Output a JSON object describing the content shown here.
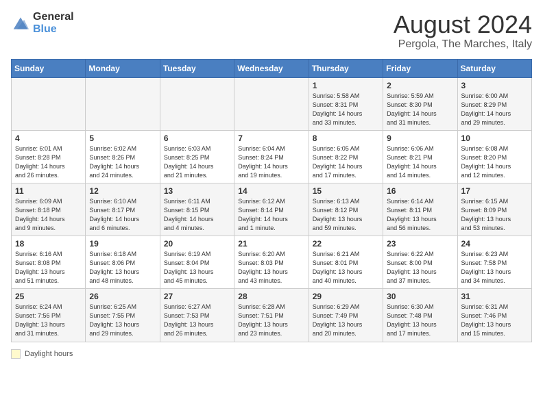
{
  "header": {
    "logo_general": "General",
    "logo_blue": "Blue",
    "month_title": "August 2024",
    "location": "Pergola, The Marches, Italy"
  },
  "days_of_week": [
    "Sunday",
    "Monday",
    "Tuesday",
    "Wednesday",
    "Thursday",
    "Friday",
    "Saturday"
  ],
  "footer": {
    "legend_label": "Daylight hours"
  },
  "weeks": [
    [
      {
        "day": "",
        "info": ""
      },
      {
        "day": "",
        "info": ""
      },
      {
        "day": "",
        "info": ""
      },
      {
        "day": "",
        "info": ""
      },
      {
        "day": "1",
        "info": "Sunrise: 5:58 AM\nSunset: 8:31 PM\nDaylight: 14 hours\nand 33 minutes."
      },
      {
        "day": "2",
        "info": "Sunrise: 5:59 AM\nSunset: 8:30 PM\nDaylight: 14 hours\nand 31 minutes."
      },
      {
        "day": "3",
        "info": "Sunrise: 6:00 AM\nSunset: 8:29 PM\nDaylight: 14 hours\nand 29 minutes."
      }
    ],
    [
      {
        "day": "4",
        "info": "Sunrise: 6:01 AM\nSunset: 8:28 PM\nDaylight: 14 hours\nand 26 minutes."
      },
      {
        "day": "5",
        "info": "Sunrise: 6:02 AM\nSunset: 8:26 PM\nDaylight: 14 hours\nand 24 minutes."
      },
      {
        "day": "6",
        "info": "Sunrise: 6:03 AM\nSunset: 8:25 PM\nDaylight: 14 hours\nand 21 minutes."
      },
      {
        "day": "7",
        "info": "Sunrise: 6:04 AM\nSunset: 8:24 PM\nDaylight: 14 hours\nand 19 minutes."
      },
      {
        "day": "8",
        "info": "Sunrise: 6:05 AM\nSunset: 8:22 PM\nDaylight: 14 hours\nand 17 minutes."
      },
      {
        "day": "9",
        "info": "Sunrise: 6:06 AM\nSunset: 8:21 PM\nDaylight: 14 hours\nand 14 minutes."
      },
      {
        "day": "10",
        "info": "Sunrise: 6:08 AM\nSunset: 8:20 PM\nDaylight: 14 hours\nand 12 minutes."
      }
    ],
    [
      {
        "day": "11",
        "info": "Sunrise: 6:09 AM\nSunset: 8:18 PM\nDaylight: 14 hours\nand 9 minutes."
      },
      {
        "day": "12",
        "info": "Sunrise: 6:10 AM\nSunset: 8:17 PM\nDaylight: 14 hours\nand 6 minutes."
      },
      {
        "day": "13",
        "info": "Sunrise: 6:11 AM\nSunset: 8:15 PM\nDaylight: 14 hours\nand 4 minutes."
      },
      {
        "day": "14",
        "info": "Sunrise: 6:12 AM\nSunset: 8:14 PM\nDaylight: 14 hours\nand 1 minute."
      },
      {
        "day": "15",
        "info": "Sunrise: 6:13 AM\nSunset: 8:12 PM\nDaylight: 13 hours\nand 59 minutes."
      },
      {
        "day": "16",
        "info": "Sunrise: 6:14 AM\nSunset: 8:11 PM\nDaylight: 13 hours\nand 56 minutes."
      },
      {
        "day": "17",
        "info": "Sunrise: 6:15 AM\nSunset: 8:09 PM\nDaylight: 13 hours\nand 53 minutes."
      }
    ],
    [
      {
        "day": "18",
        "info": "Sunrise: 6:16 AM\nSunset: 8:08 PM\nDaylight: 13 hours\nand 51 minutes."
      },
      {
        "day": "19",
        "info": "Sunrise: 6:18 AM\nSunset: 8:06 PM\nDaylight: 13 hours\nand 48 minutes."
      },
      {
        "day": "20",
        "info": "Sunrise: 6:19 AM\nSunset: 8:04 PM\nDaylight: 13 hours\nand 45 minutes."
      },
      {
        "day": "21",
        "info": "Sunrise: 6:20 AM\nSunset: 8:03 PM\nDaylight: 13 hours\nand 43 minutes."
      },
      {
        "day": "22",
        "info": "Sunrise: 6:21 AM\nSunset: 8:01 PM\nDaylight: 13 hours\nand 40 minutes."
      },
      {
        "day": "23",
        "info": "Sunrise: 6:22 AM\nSunset: 8:00 PM\nDaylight: 13 hours\nand 37 minutes."
      },
      {
        "day": "24",
        "info": "Sunrise: 6:23 AM\nSunset: 7:58 PM\nDaylight: 13 hours\nand 34 minutes."
      }
    ],
    [
      {
        "day": "25",
        "info": "Sunrise: 6:24 AM\nSunset: 7:56 PM\nDaylight: 13 hours\nand 31 minutes."
      },
      {
        "day": "26",
        "info": "Sunrise: 6:25 AM\nSunset: 7:55 PM\nDaylight: 13 hours\nand 29 minutes."
      },
      {
        "day": "27",
        "info": "Sunrise: 6:27 AM\nSunset: 7:53 PM\nDaylight: 13 hours\nand 26 minutes."
      },
      {
        "day": "28",
        "info": "Sunrise: 6:28 AM\nSunset: 7:51 PM\nDaylight: 13 hours\nand 23 minutes."
      },
      {
        "day": "29",
        "info": "Sunrise: 6:29 AM\nSunset: 7:49 PM\nDaylight: 13 hours\nand 20 minutes."
      },
      {
        "day": "30",
        "info": "Sunrise: 6:30 AM\nSunset: 7:48 PM\nDaylight: 13 hours\nand 17 minutes."
      },
      {
        "day": "31",
        "info": "Sunrise: 6:31 AM\nSunset: 7:46 PM\nDaylight: 13 hours\nand 15 minutes."
      }
    ]
  ]
}
